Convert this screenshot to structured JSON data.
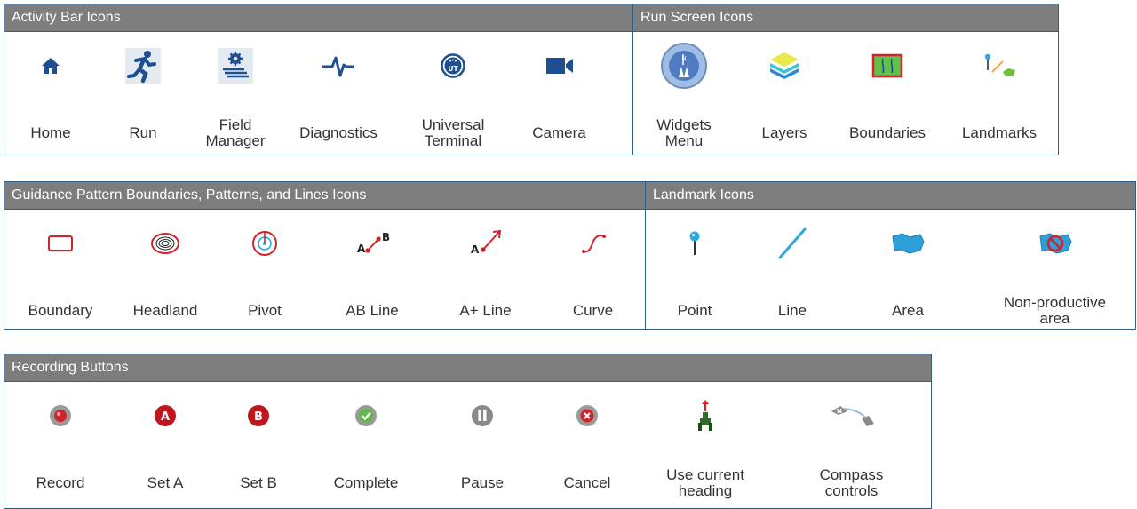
{
  "activity_bar": {
    "title": "Activity Bar Icons",
    "items": [
      {
        "label": "Home",
        "icon": "home-icon"
      },
      {
        "label": "Run",
        "icon": "runner-icon"
      },
      {
        "label": "Field\nManager",
        "icon": "field-manager-icon"
      },
      {
        "label": "Diagnostics",
        "icon": "heartbeat-icon"
      },
      {
        "label": "Universal\nTerminal",
        "icon": "universal-terminal-icon"
      },
      {
        "label": "Camera",
        "icon": "camera-icon"
      }
    ]
  },
  "run_screen": {
    "title": "Run Screen Icons",
    "items": [
      {
        "label": "Widgets\nMenu",
        "icon": "compass-widget-icon"
      },
      {
        "label": "Layers",
        "icon": "layers-icon"
      },
      {
        "label": "Boundaries",
        "icon": "boundaries-icon"
      },
      {
        "label": "Landmarks",
        "icon": "landmarks-icon"
      }
    ]
  },
  "guidance": {
    "title": "Guidance Pattern Boundaries, Patterns, and Lines Icons",
    "items": [
      {
        "label": "Boundary",
        "icon": "boundary-icon"
      },
      {
        "label": "Headland",
        "icon": "headland-icon"
      },
      {
        "label": "Pivot",
        "icon": "pivot-icon"
      },
      {
        "label": "AB Line",
        "icon": "ab-line-icon",
        "text_a": "A",
        "text_b": "B"
      },
      {
        "label": "A+ Line",
        "icon": "a-plus-line-icon",
        "text_a": "A"
      },
      {
        "label": "Curve",
        "icon": "curve-icon"
      }
    ]
  },
  "landmark": {
    "title": "Landmark Icons",
    "items": [
      {
        "label": "Point",
        "icon": "point-pin-icon"
      },
      {
        "label": "Line",
        "icon": "line-icon"
      },
      {
        "label": "Area",
        "icon": "area-icon"
      },
      {
        "label": "Non-productive\narea",
        "icon": "non-productive-area-icon"
      }
    ]
  },
  "recording": {
    "title": "Recording Buttons",
    "items": [
      {
        "label": "Record",
        "icon": "record-icon"
      },
      {
        "label": "Set A",
        "icon": "set-a-icon",
        "badge": "A"
      },
      {
        "label": "Set B",
        "icon": "set-b-icon",
        "badge": "B"
      },
      {
        "label": "Complete",
        "icon": "checkmark-icon"
      },
      {
        "label": "Pause",
        "icon": "pause-icon"
      },
      {
        "label": "Cancel",
        "icon": "cancel-icon"
      },
      {
        "label": "Use current\nheading",
        "icon": "tractor-heading-icon"
      },
      {
        "label": "Compass\ncontrols",
        "icon": "compass-controls-icon",
        "badge_n": "N"
      }
    ]
  },
  "colors": {
    "header_bg": "#7d7d7d",
    "border": "#2f5f85",
    "icon_blue": "#1d4f91",
    "icon_red": "#d2232a",
    "accent_cyan": "#2ea8e0"
  }
}
